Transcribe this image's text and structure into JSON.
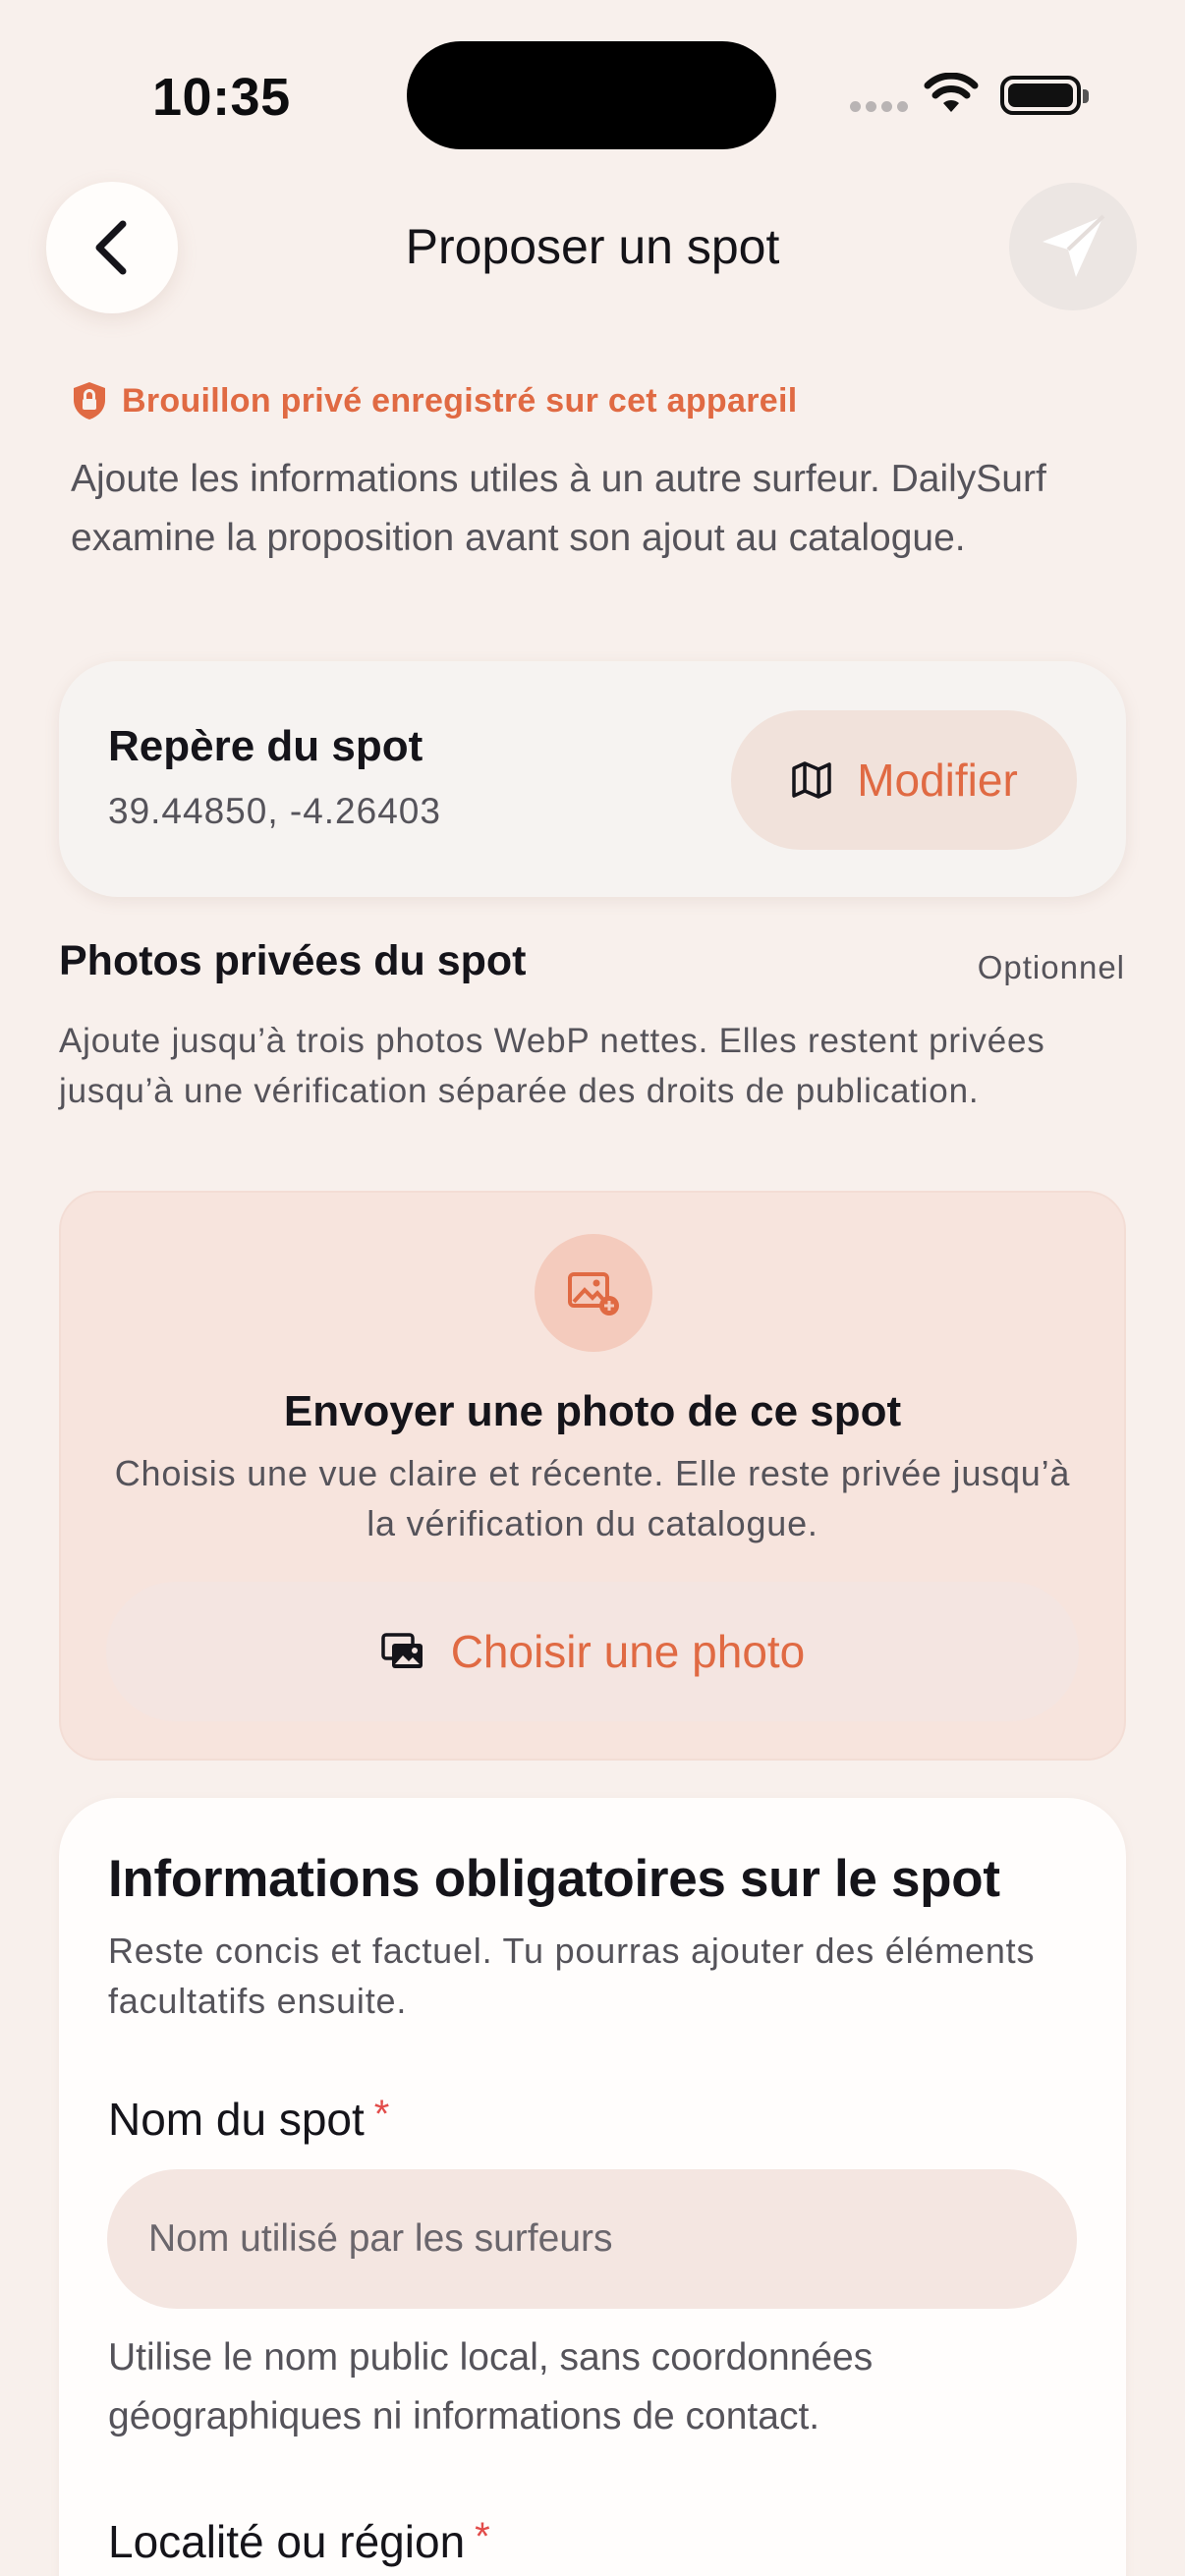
{
  "status_bar": {
    "time": "10:35"
  },
  "header": {
    "title": "Proposer un spot",
    "back_icon": "chevron-left-icon",
    "send_icon": "paper-plane-icon"
  },
  "draft_notice": {
    "text": "Brouillon privé enregistré sur cet appareil",
    "icon": "shield-lock-icon"
  },
  "intro": "Ajoute les informations utiles à un autre surfeur. DailySurf examine la proposition avant son ajout au catalogue.",
  "location_card": {
    "title": "Repère du spot",
    "coordinates": "39.44850, -4.26403",
    "modify_label": "Modifier",
    "modify_icon": "map-icon"
  },
  "photos": {
    "heading": "Photos privées du spot",
    "optional_label": "Optionnel",
    "description": "Ajoute jusqu’à trois photos WebP nettes. Elles restent privées jusqu’à une vérification séparée des droits de publication.",
    "upload_title": "Envoyer une photo de ce spot",
    "upload_description": "Choisis une vue claire et récente. Elle reste privée jusqu’à la vérification du catalogue.",
    "choose_label": "Choisir une photo",
    "upload_icon": "image-add-icon",
    "choose_icon": "photo-stack-icon"
  },
  "required_info": {
    "title": "Informations obligatoires sur le spot",
    "description": "Reste concis et factuel. Tu pourras ajouter des éléments facultatifs ensuite.",
    "name_label": "Nom du spot",
    "required_mark": "*",
    "name_placeholder": "Nom utilisé par les surfeurs",
    "name_help": "Utilise le nom public local, sans coordonnées géographiques ni informations de contact.",
    "region_label": "Localité ou région"
  },
  "colors": {
    "accent": "#e06a43",
    "background": "#f8f0ec",
    "required": "#e24c4a"
  }
}
